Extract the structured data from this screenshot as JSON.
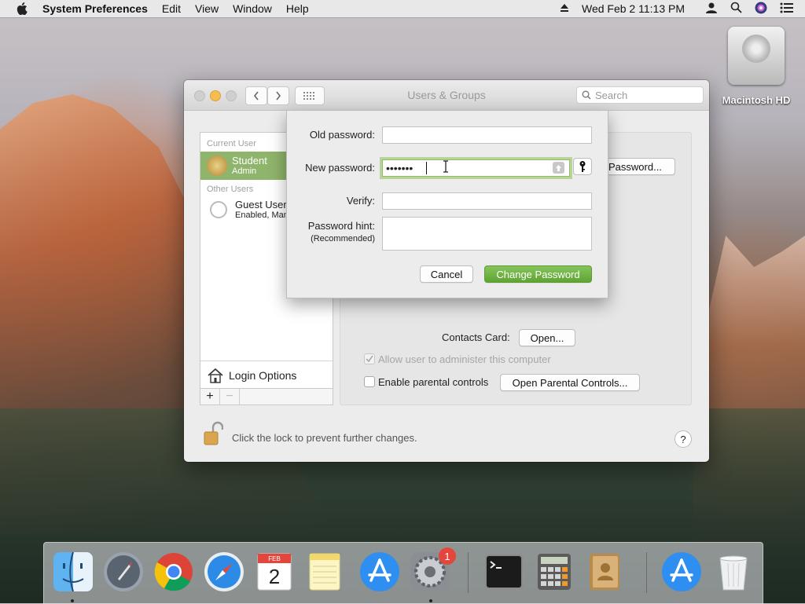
{
  "menubar": {
    "app_name": "System Preferences",
    "items": [
      "Edit",
      "View",
      "Window",
      "Help"
    ],
    "clock": "Wed Feb 2  11:13 PM"
  },
  "desktop": {
    "drive_label": "Macintosh HD"
  },
  "window": {
    "title": "Users & Groups",
    "search_placeholder": "Search",
    "sidebar": {
      "current_user_header": "Current User",
      "current_user": {
        "name": "Student",
        "role": "Admin"
      },
      "other_users_header": "Other Users",
      "other_user": {
        "name": "Guest User",
        "status": "Enabled, Man"
      },
      "login_options": "Login Options",
      "add": "+",
      "remove": "−"
    },
    "panel": {
      "change_password_button": "Password...",
      "contacts_card_label": "Contacts Card:",
      "contacts_open_button": "Open...",
      "allow_admin_label": "Allow user to administer this computer",
      "allow_admin_checked": true,
      "allow_admin_enabled": false,
      "parental_controls_label": "Enable parental controls",
      "parental_controls_checked": false,
      "open_parental_button": "Open Parental Controls..."
    },
    "footer": {
      "lock_text": "Click the lock to prevent further changes.",
      "help": "?"
    }
  },
  "sheet": {
    "old_password_label": "Old password:",
    "old_password_value": "",
    "new_password_label": "New password:",
    "new_password_value": "•••••••",
    "verify_label": "Verify:",
    "verify_value": "",
    "hint_label": "Password hint:",
    "hint_sublabel": "(Recommended)",
    "hint_value": "",
    "cancel_button": "Cancel",
    "change_button": "Change Password"
  },
  "dock": {
    "calendar_month": "FEB",
    "calendar_day": "2",
    "sysprefs_badge": "1"
  },
  "colors": {
    "accent_green": "#6fb244",
    "selection_green": "#8fb46b",
    "badge_red": "#e5463b"
  }
}
